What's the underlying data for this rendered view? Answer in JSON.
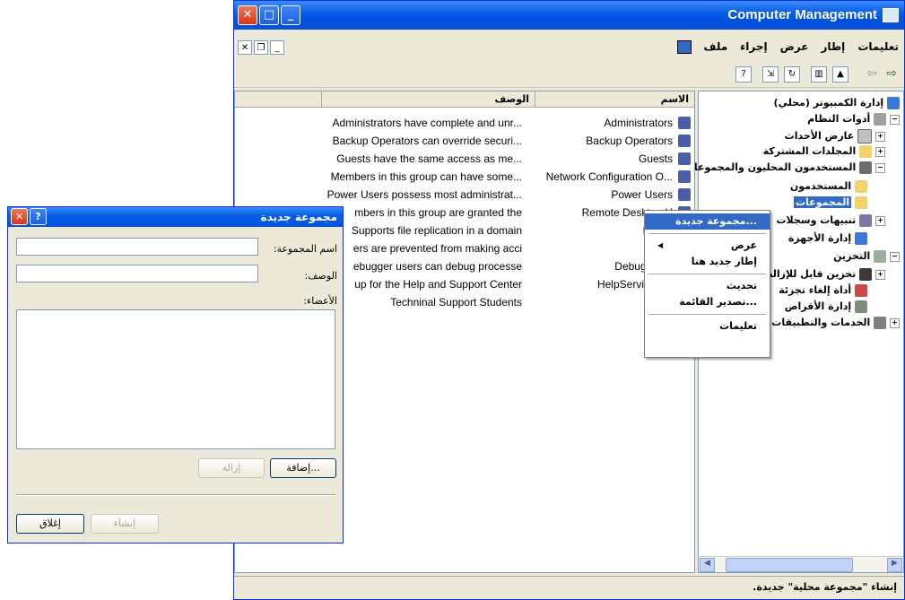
{
  "main_window": {
    "title": "Computer Management",
    "menu": [
      "ملف",
      "إجراء",
      "عرض",
      "إطار",
      "تعليمات"
    ],
    "status": "إنشاء \"مجموعة محلية\" جديدة."
  },
  "tree": {
    "root": "إدارة الكمبيوتر (محلي)",
    "items": [
      "أدوات النظام",
      "عارض الأحداث",
      "المجلدات المشتركة",
      "المستخدمون المحليون والمجموعات",
      "المستخدمون",
      "المجموعات",
      "تنبيهات وسجلات",
      "إدارة الأجهزة",
      "التخزين",
      "تخزين قابل للإزالة",
      "أداة إلغاء تجزئة",
      "إدارة الأقراص",
      "الخدمات والتطبيقات"
    ]
  },
  "list": {
    "col_name": "الاسم",
    "col_desc": "الوصف",
    "rows": [
      {
        "name": "Administrators",
        "desc": "Administrators have complete and unr..."
      },
      {
        "name": "Backup Operators",
        "desc": "Backup Operators can override securi..."
      },
      {
        "name": "Guests",
        "desc": "Guests have the same access as me..."
      },
      {
        "name": "Network Configuration O...",
        "desc": "Members in this group can have some..."
      },
      {
        "name": "Power Users",
        "desc": "Power Users possess most administrat..."
      },
      {
        "name": "Remote Desktop U",
        "desc": "mbers in this group are granted the"
      },
      {
        "name": "Replic",
        "desc": "Supports file replication in a domain"
      },
      {
        "name": "U",
        "desc": "ers are prevented from making acci"
      },
      {
        "name": "Debugger U",
        "desc": "ebugger users can debug processe"
      },
      {
        "name": "HelpServicesGr",
        "desc": "up for the Help and Support Center"
      },
      {
        "name": "Tech",
        "desc": "Techninal Support Students"
      }
    ]
  },
  "context_menu": {
    "items": [
      "مجموعة جديدة...",
      "عرض",
      "إطار جديد هنا",
      "تحديث",
      "تصدير القائمة...",
      "تعليمات"
    ]
  },
  "dialog": {
    "title": "مجموعة جديدة",
    "group_name_label": "اسم المجموعة:",
    "group_name_value": "",
    "description_label": "الوصف:",
    "members_label": "الأعضاء:",
    "add_button": "إضافة...",
    "remove_button": "إزالة",
    "create_button": "إنشاء",
    "close_button": "إغلاق"
  },
  "colors": {
    "title_blue": "#0053e1",
    "close_red": "#d5381a",
    "window_bg": "#ece9d8",
    "highlight": "#316ac5"
  }
}
